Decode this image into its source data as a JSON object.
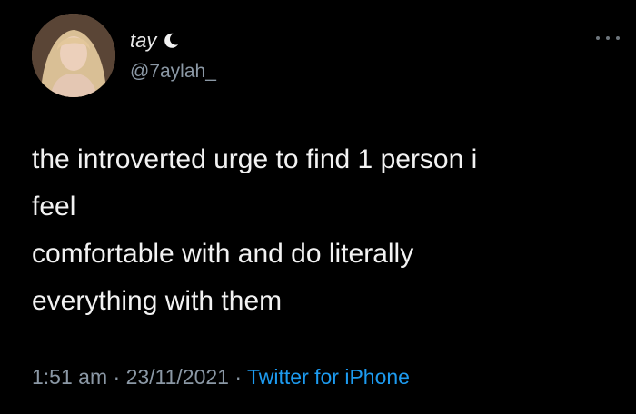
{
  "user": {
    "display_name": "tay",
    "handle": "@7aylah_",
    "avatar_icon": "profile-photo"
  },
  "tweet": {
    "lines": [
      "the introverted urge to find 1 person i",
      "feel",
      "comfortable with and do literally",
      "everything with them"
    ]
  },
  "meta": {
    "time": "1:51 am",
    "date": "23/11/2021",
    "source": "Twitter for iPhone",
    "separator": " · "
  },
  "icons": {
    "name_emoji": "moon-icon",
    "overflow": "more-icon"
  },
  "colors": {
    "background": "#000000",
    "text": "#f2f2f2",
    "secondary": "#8b98a5",
    "link": "#1d9bf0"
  }
}
